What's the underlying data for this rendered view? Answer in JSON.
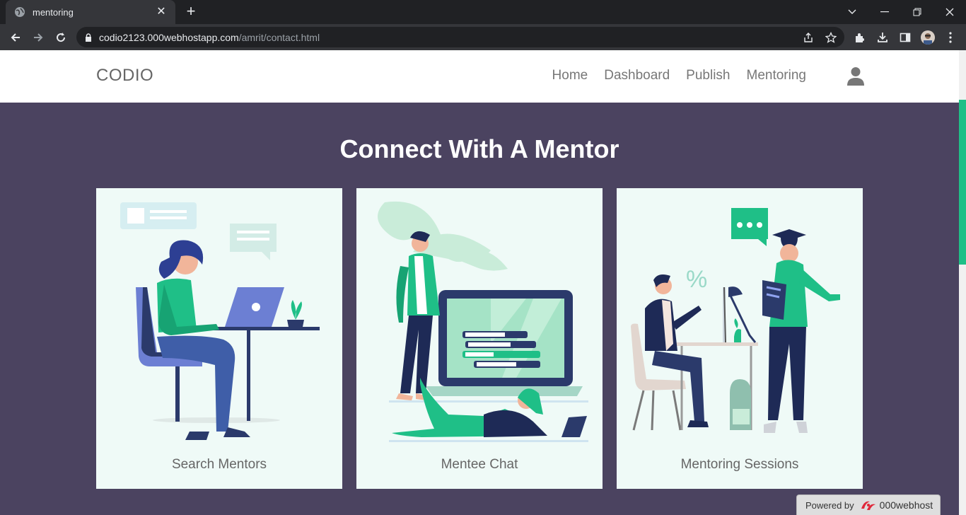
{
  "browser": {
    "tab_title": "mentoring",
    "url_host": "codio2123.000webhostapp.com",
    "url_path": "/amrit/contact.html"
  },
  "site": {
    "brand": "CODIO",
    "nav": [
      "Home",
      "Dashboard",
      "Publish",
      "Mentoring"
    ]
  },
  "main": {
    "heading": "Connect With A Mentor",
    "cards": [
      {
        "label": "Search Mentors"
      },
      {
        "label": "Mentee Chat"
      },
      {
        "label": "Mentoring Sessions"
      }
    ]
  },
  "footer_badge": {
    "prefix": "Powered by",
    "brand": "000webhost"
  },
  "colors": {
    "background": "#4b4360",
    "card": "#effaf7",
    "accent": "#1fbf87"
  }
}
